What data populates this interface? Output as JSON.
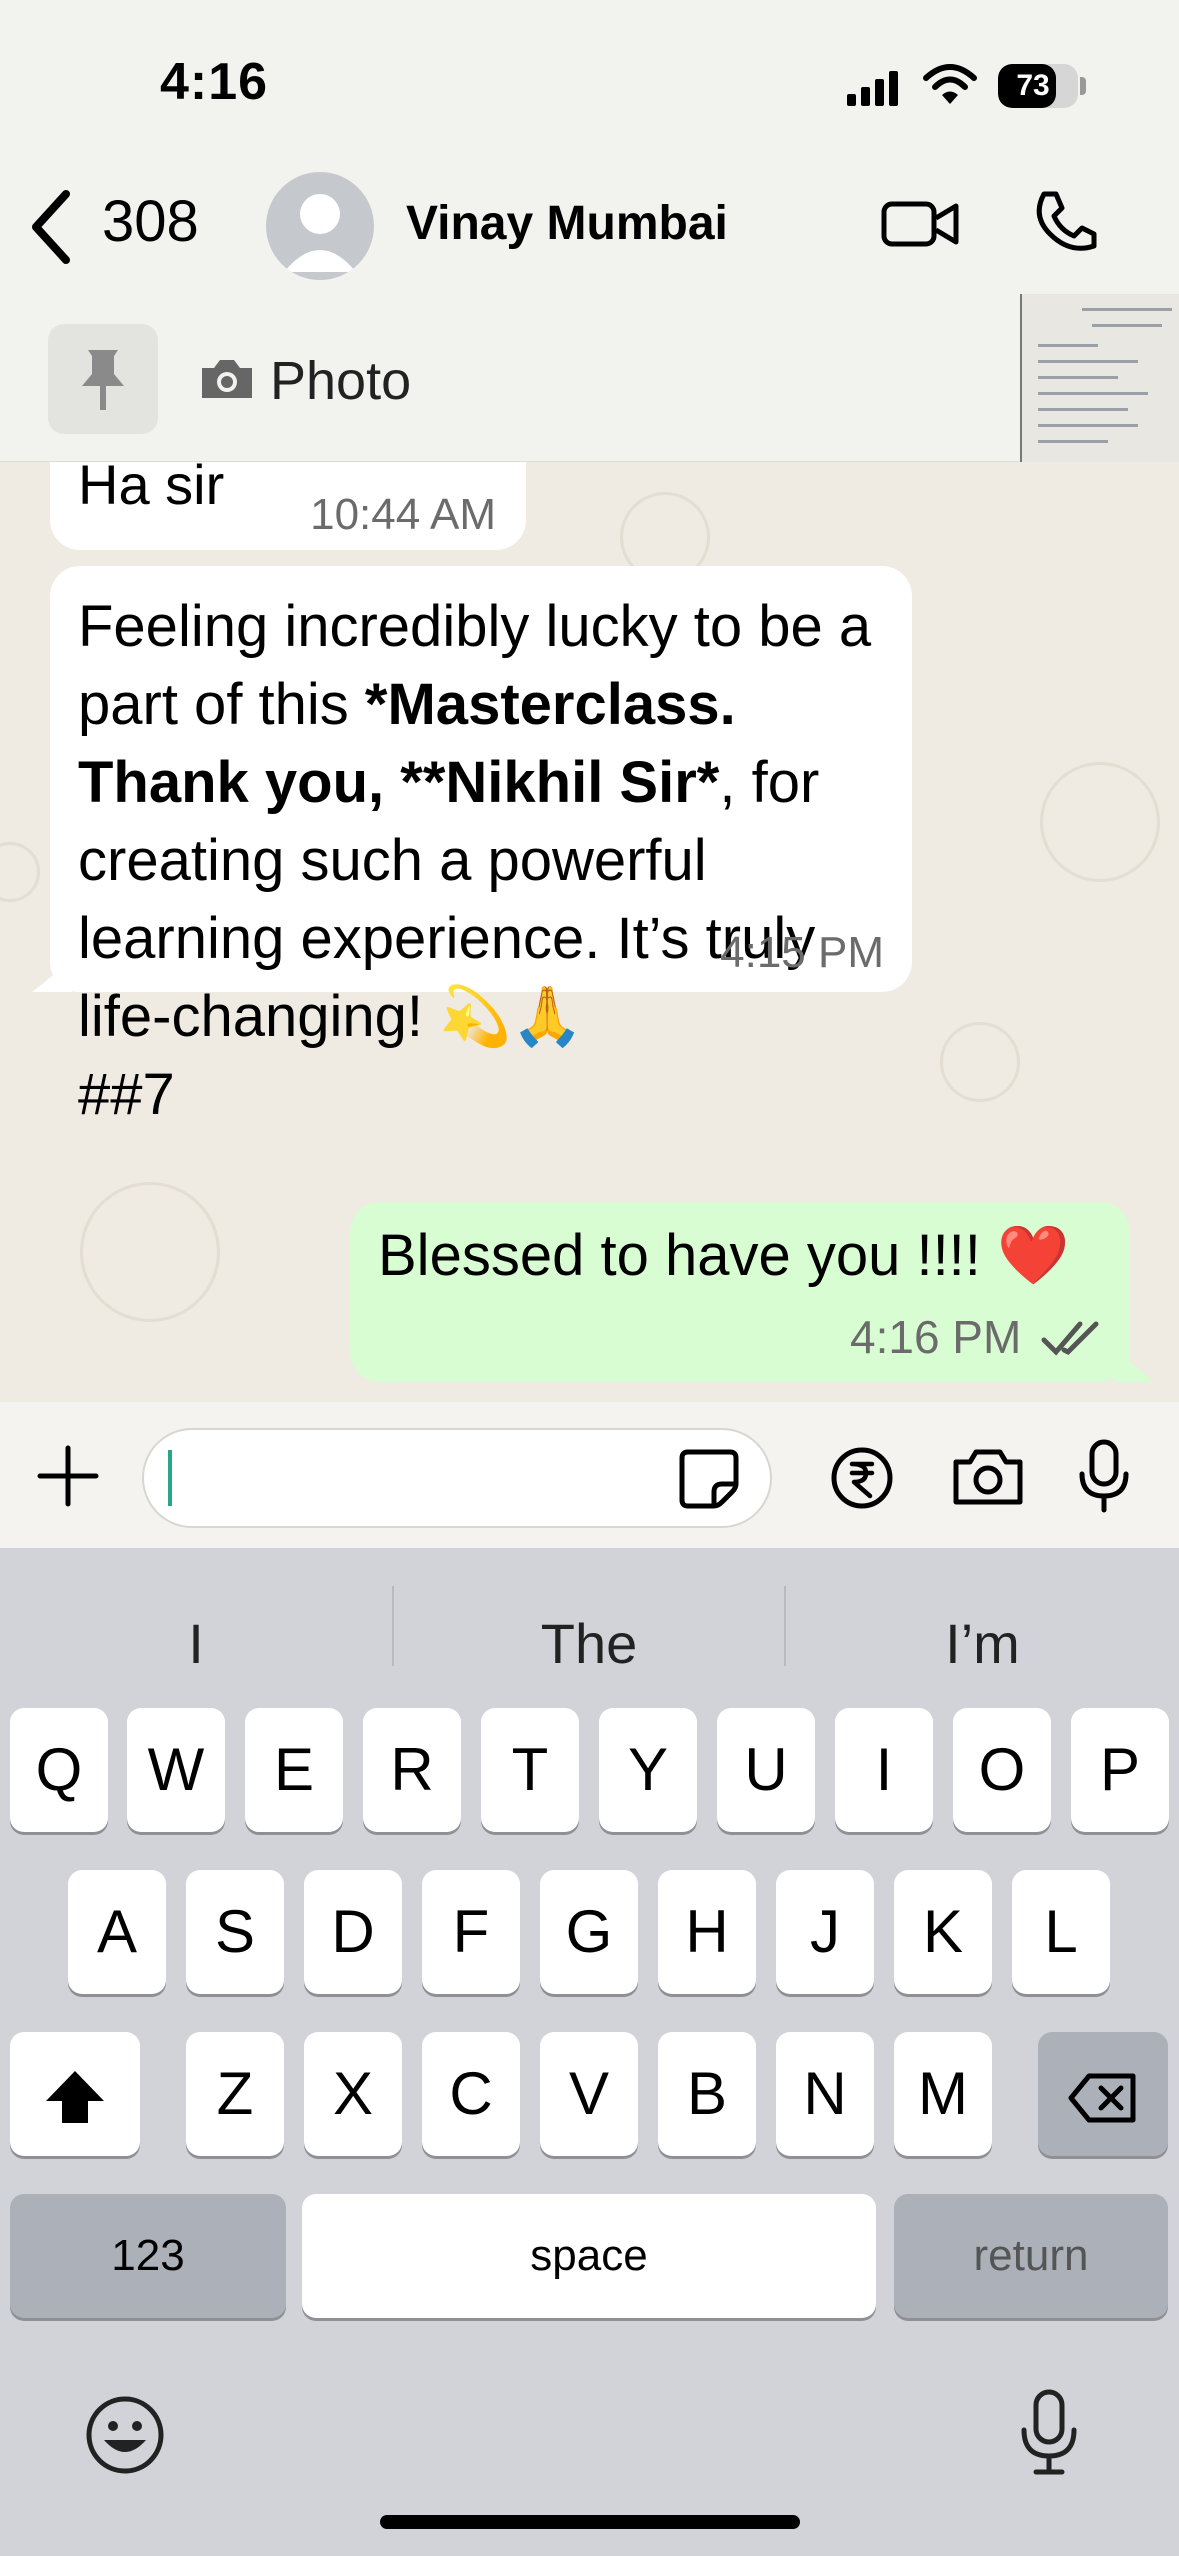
{
  "status_bar": {
    "time": "4:16",
    "battery": "73",
    "battery_level": 0.73
  },
  "header": {
    "back_count": "308",
    "contact_name": "Vinay Mumbai"
  },
  "pinned": {
    "label": "Photo"
  },
  "messages": [
    {
      "direction": "in",
      "text": "Ha sir",
      "time": "10:44 AM"
    },
    {
      "direction": "in",
      "text_parts": [
        "Feeling incredibly lucky to be a part of this ",
        "*Masterclass. Thank you, **Nikhil Sir*",
        ", for creating such a powerful learning experience. It’s truly life-changing! 💫🙏",
        "##7"
      ],
      "time": "4:15 PM"
    },
    {
      "direction": "out",
      "text": "Blessed to have you !!!! ❤️",
      "time": "4:16 PM",
      "status": "read"
    }
  ],
  "input": {
    "value": ""
  },
  "keyboard": {
    "suggestions": [
      "I",
      "The",
      "I’m"
    ],
    "row1": [
      "Q",
      "W",
      "E",
      "R",
      "T",
      "Y",
      "U",
      "I",
      "O",
      "P"
    ],
    "row2": [
      "A",
      "S",
      "D",
      "F",
      "G",
      "H",
      "J",
      "K",
      "L"
    ],
    "row3": [
      "Z",
      "X",
      "C",
      "V",
      "B",
      "N",
      "M"
    ],
    "numbers_key": "123",
    "space_key": "space",
    "return_key": "return"
  }
}
